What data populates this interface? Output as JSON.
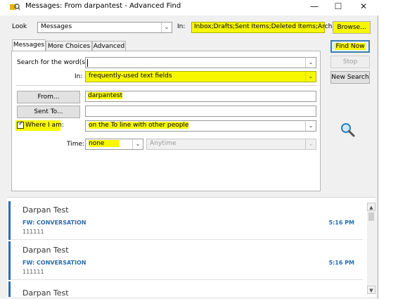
{
  "window": {
    "title": "Messages: From darpantest - Advanced Find",
    "minimize": "—",
    "maximize": "☐",
    "close": "✕"
  },
  "look": {
    "label": "Look",
    "value": "Messages",
    "in_label": "In:",
    "in_value": "Inbox;Drafts;Sent Items;Deleted Items;Archive"
  },
  "tabs": [
    {
      "label": "Messages"
    },
    {
      "label": "More Choices"
    },
    {
      "label": "Advanced"
    }
  ],
  "form": {
    "search_label": "Search for the word(s):",
    "search_value": "",
    "in_label": "In:",
    "in_value": "frequently-used text fields",
    "from_button": "From...",
    "from_value": "darpantest",
    "sentto_button": "Sent To...",
    "sentto_value": "",
    "where_label": "Where I am:",
    "where_value": "on the To line with other people",
    "time_label": "Time:",
    "time_value": "none",
    "time_range": "Anytime"
  },
  "buttons": {
    "browse": "Browse...",
    "find_now": "Find Now",
    "stop": "Stop",
    "new_search": "New Search"
  },
  "results": [
    {
      "sender": "Darpan Test",
      "subject": "FW: CONVERSATION",
      "preview": "111111",
      "time": "5:16 PM"
    },
    {
      "sender": "Darpan Test",
      "subject": "FW: CONVERSATION",
      "preview": "111111",
      "time": "5:16 PM"
    },
    {
      "sender": "Darpan Test",
      "subject": "",
      "preview": "",
      "time": ""
    }
  ],
  "scrollbar": {
    "up": "▲",
    "down": "▼"
  },
  "colors": {
    "highlight": "#f7f700",
    "accent": "#2b6cb0"
  }
}
